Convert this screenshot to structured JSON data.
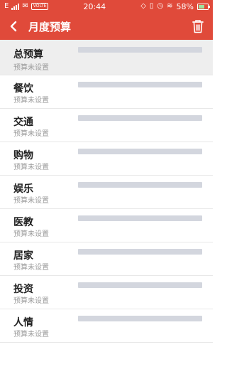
{
  "status_bar": {
    "left_glyph": "E",
    "net_badge": "VOLTE",
    "time": "20:44",
    "battery_percent": "58%",
    "battery_level": 0.58
  },
  "header": {
    "title": "月度预算",
    "accent_color": "#e04a3a"
  },
  "total": {
    "label": "总预算",
    "status": "预算未设置"
  },
  "categories": [
    {
      "label": "餐饮",
      "status": "预算未设置"
    },
    {
      "label": "交通",
      "status": "预算未设置"
    },
    {
      "label": "购物",
      "status": "预算未设置"
    },
    {
      "label": "娱乐",
      "status": "预算未设置"
    },
    {
      "label": "医教",
      "status": "预算未设置"
    },
    {
      "label": "居家",
      "status": "预算未设置"
    },
    {
      "label": "投资",
      "status": "预算未设置"
    },
    {
      "label": "人情",
      "status": "预算未设置"
    }
  ],
  "icons": {
    "back": "chevron-left-icon",
    "delete": "trash-icon"
  }
}
